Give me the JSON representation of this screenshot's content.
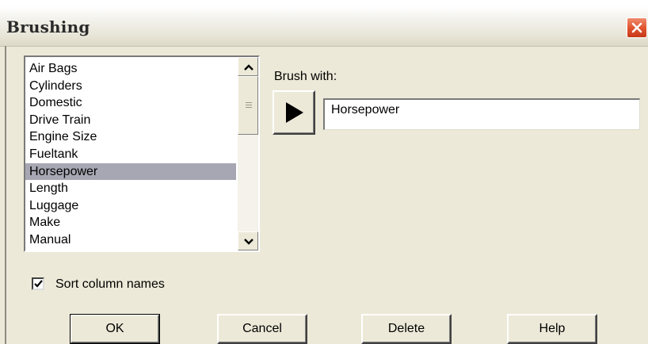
{
  "window": {
    "title": "Brushing"
  },
  "list": {
    "items": [
      "Air Bags",
      "Cylinders",
      "Domestic",
      "Drive Train",
      "Engine Size",
      "Fueltank",
      "Horsepower",
      "Length",
      "Luggage",
      "Make",
      "Manual"
    ],
    "selected": "Horsepower"
  },
  "brush": {
    "label": "Brush with:",
    "value": "Horsepower"
  },
  "sort": {
    "label": "Sort column names",
    "checked": true
  },
  "buttons": {
    "ok": "OK",
    "cancel": "Cancel",
    "delete": "Delete",
    "help": "Help"
  },
  "colors": {
    "dialog_bg": "#ece9d8",
    "selection": "#a7a7b3",
    "close_red": "#e0502c"
  },
  "icons": {
    "close": "close-x-icon",
    "scroll_up": "chevron-up-icon",
    "scroll_down": "chevron-down-icon",
    "play": "play-triangle-icon",
    "check": "checkmark-icon"
  }
}
